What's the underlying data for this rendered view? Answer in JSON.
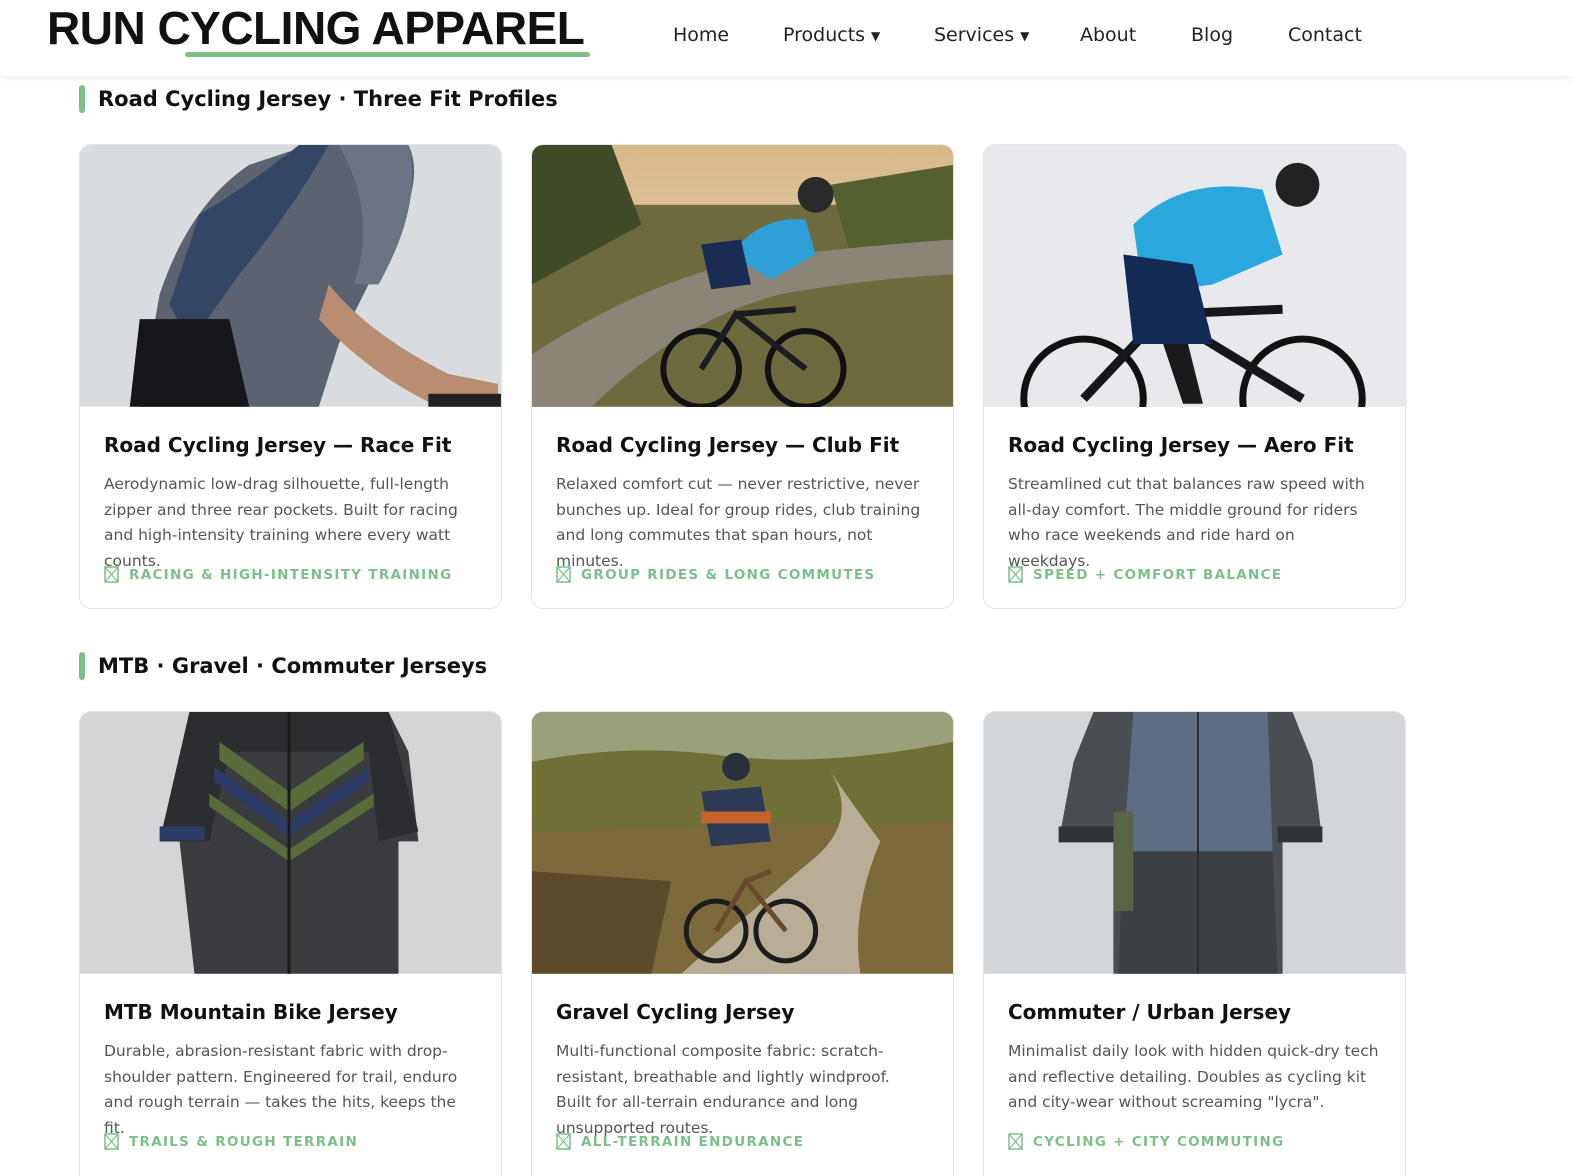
{
  "brand": {
    "name": "RUN CYCLING APPAREL",
    "accent": "#7cbf87"
  },
  "nav": {
    "items": [
      {
        "label": "Home",
        "has_dropdown": false
      },
      {
        "label": "Products",
        "has_dropdown": true
      },
      {
        "label": "Services",
        "has_dropdown": true
      },
      {
        "label": "About",
        "has_dropdown": false
      },
      {
        "label": "Blog",
        "has_dropdown": false
      },
      {
        "label": "Contact",
        "has_dropdown": false
      }
    ],
    "caret": "▼"
  },
  "sections": [
    {
      "title": "Road Cycling Jersey · Three Fit Profiles",
      "cards": [
        {
          "title": "Road Cycling Jersey — Race Fit",
          "description": "Aerodynamic low-drag silhouette, full-length zipper and three rear pockets. Built for racing and high-intensity training where every watt counts.",
          "tag": "RACING & HIGH-INTENSITY TRAINING"
        },
        {
          "title": "Road Cycling Jersey — Club Fit",
          "description": "Relaxed comfort cut — never restrictive, never bunches up. Ideal for group rides, club training and long commutes that span hours, not minutes.",
          "tag": "GROUP RIDES & LONG COMMUTES"
        },
        {
          "title": "Road Cycling Jersey — Aero Fit",
          "description": "Streamlined cut that balances raw speed with all-day comfort. The middle ground for riders who race weekends and ride hard on weekdays.",
          "tag": "SPEED + COMFORT BALANCE"
        }
      ]
    },
    {
      "title": "MTB · Gravel · Commuter Jerseys",
      "cards": [
        {
          "title": "MTB Mountain Bike Jersey",
          "description": "Durable, abrasion-resistant fabric with drop-shoulder pattern. Engineered for trail, enduro and rough terrain — takes the hits, keeps the fit.",
          "tag": "TRAILS & ROUGH TERRAIN"
        },
        {
          "title": "Gravel Cycling Jersey",
          "description": "Multi-functional composite fabric: scratch-resistant, breathable and lightly windproof. Built for all-terrain endurance and long unsupported routes.",
          "tag": "ALL-TERRAIN ENDURANCE"
        },
        {
          "title": "Commuter / Urban Jersey",
          "description": "Minimalist daily look with hidden quick-dry tech and reflective detailing. Doubles as cycling kit and city-wear without screaming \"lycra\".",
          "tag": "CYCLING + CITY COMMUTING"
        }
      ]
    }
  ],
  "icons": {
    "tag_icon": "hourglass-icon"
  }
}
